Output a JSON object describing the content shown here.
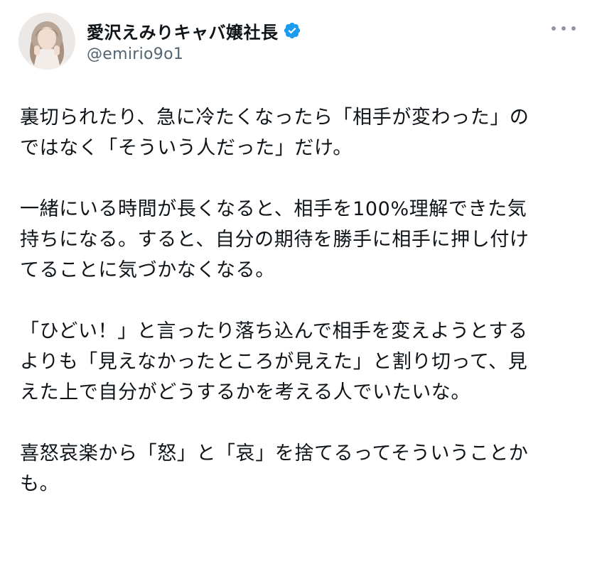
{
  "author": {
    "display_name": "愛沢えみりキャバ嬢社長",
    "handle": "@emirio9o1",
    "avatar_icon": "profile-photo",
    "verified_icon": "verified-badge-icon",
    "verified_color": "#1d9bf0"
  },
  "menu": {
    "icon": "more-options-icon"
  },
  "tweet": {
    "paragraphs": [
      {
        "lines": [
          "裏切られたり、急に冷たくなったら「相手が変わった」の",
          "ではなく「そういう人だった」だけ。"
        ]
      },
      {
        "lines": [
          "一緒にいる時間が長くなると、相手を100%理解できた気",
          "持ちになる。すると、自分の期待を勝手に相手に押し付け",
          "てることに気づかなくなる。"
        ]
      },
      {
        "lines": [
          "「ひどい！」と言ったり落ち込んで相手を変えようとする",
          "よりも「見えなかったところが見えた」と割り切って、見",
          "えた上で自分がどうするかを考える人でいたいな。"
        ]
      },
      {
        "lines": [
          "喜怒哀楽から「怒」と「哀」を捨てるってそういうことか",
          "も。"
        ]
      }
    ]
  }
}
